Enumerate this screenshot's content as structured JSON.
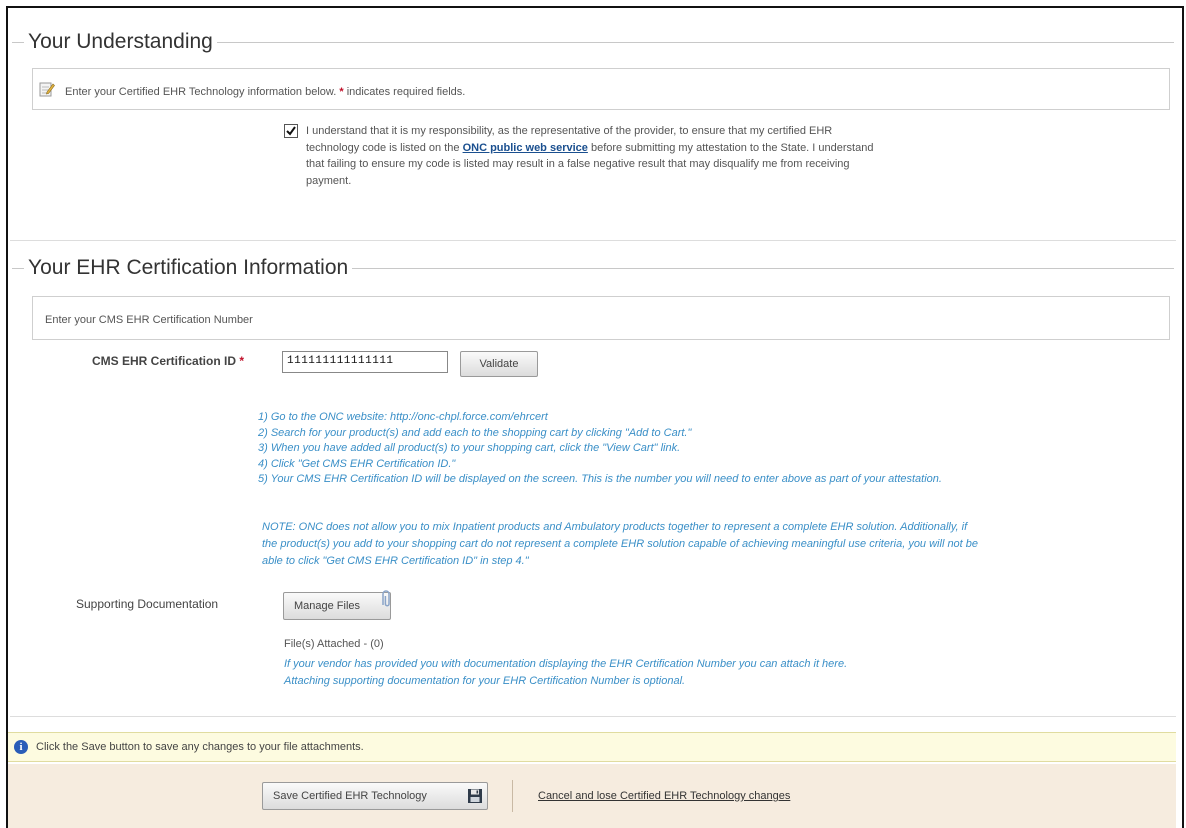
{
  "understanding": {
    "section_title": "Your Understanding",
    "info_text": "Enter your Certified EHR Technology information below.",
    "required_marker": "*",
    "required_text": "indicates required fields.",
    "checkbox_checked": true,
    "agreement_line1_pre": "I understand that it is my responsibility, as the representative of the provider, to ensure that my certified EHR",
    "agreement_line2_pre": "technology code is listed on the",
    "agreement_link": "ONC public web service",
    "agreement_line2_post": "before submitting my attestation to the State. I understand",
    "agreement_line3": "that failing to ensure my code is listed may result in a false negative result that may disqualify me from receiving",
    "agreement_line4": "payment."
  },
  "certification": {
    "section_title": "Your EHR Certification Information",
    "info_text": "Enter your CMS EHR Certification Number",
    "id_label": "CMS EHR Certification ID",
    "required_marker": "*",
    "id_value": "111111111111111",
    "validate_label": "Validate",
    "steps": [
      "1) Go to the ONC website: http://onc-chpl.force.com/ehrcert",
      "2) Search for your product(s) and add each to the shopping cart by clicking \"Add to Cart.\"",
      "3) When you have added all product(s) to your shopping cart, click the \"View Cart\" link.",
      "4) Click \"Get CMS EHR Certification ID.\"",
      "5) Your CMS EHR Certification ID will be displayed on the screen. This is the number you will need to enter above as part of your attestation."
    ],
    "note_lines": [
      "NOTE: ONC does not allow you to mix Inpatient products and Ambulatory products together to represent a complete EHR solution. Additionally, if",
      "the product(s) you add to your shopping cart do not represent a complete EHR solution capable of achieving meaningful use criteria, you will not be",
      "able to click \"Get CMS EHR Certification ID\" in step 4.\""
    ],
    "supporting_label": "Supporting Documentation",
    "manage_files_label": "Manage Files",
    "files_attached": "File(s) Attached - (0)",
    "attach_help_1": "If your vendor has provided you with documentation displaying the EHR Certification Number you can attach it here.",
    "attach_help_2": "Attaching supporting documentation for your EHR Certification Number is optional."
  },
  "notice": {
    "text": "Click the Save button to save any changes to your file attachments.",
    "icon": "info-icon"
  },
  "footer": {
    "save_label": "Save Certified EHR Technology",
    "save_icon": "floppy-disk-icon",
    "cancel_label": "Cancel and lose Certified EHR Technology changes"
  }
}
